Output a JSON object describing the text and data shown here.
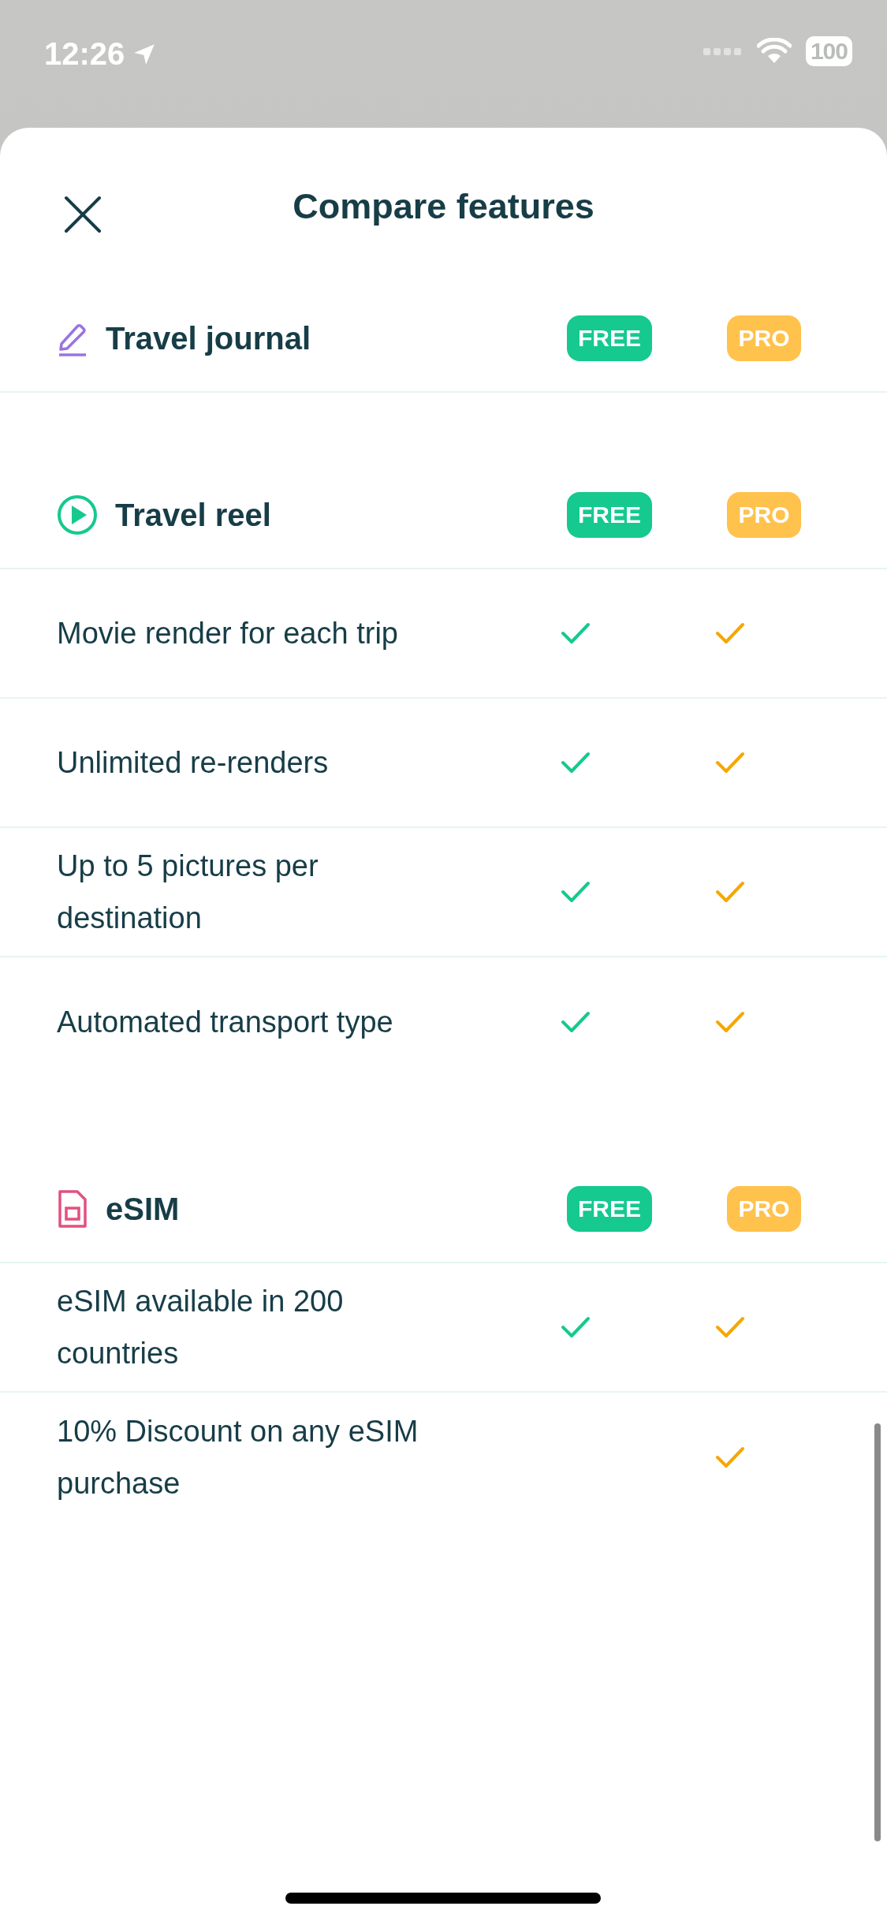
{
  "status_bar": {
    "time": "12:26",
    "battery": "100"
  },
  "header": {
    "title": "Compare features"
  },
  "sections": [
    {
      "title": "Travel journal",
      "kind": "pencil",
      "free_label": "FREE",
      "pro_label": "PRO"
    },
    {
      "title": "Travel reel",
      "kind": "play",
      "free_label": "FREE",
      "pro_label": "PRO",
      "features": [
        {
          "label": "Movie render for each trip",
          "free": true,
          "pro": true
        },
        {
          "label": "Unlimited re-renders",
          "free": true,
          "pro": true
        },
        {
          "label": "Up to 5 pictures per destination",
          "free": true,
          "pro": true
        },
        {
          "label": "Automated transport type",
          "free": true,
          "pro": true
        }
      ]
    },
    {
      "title": "eSIM",
      "kind": "sim",
      "free_label": "FREE",
      "pro_label": "PRO",
      "features": [
        {
          "label": "eSIM available in 200 countries",
          "free": true,
          "pro": true
        },
        {
          "label": "10% Discount on any eSIM purchase",
          "free": false,
          "pro": true
        }
      ]
    }
  ]
}
